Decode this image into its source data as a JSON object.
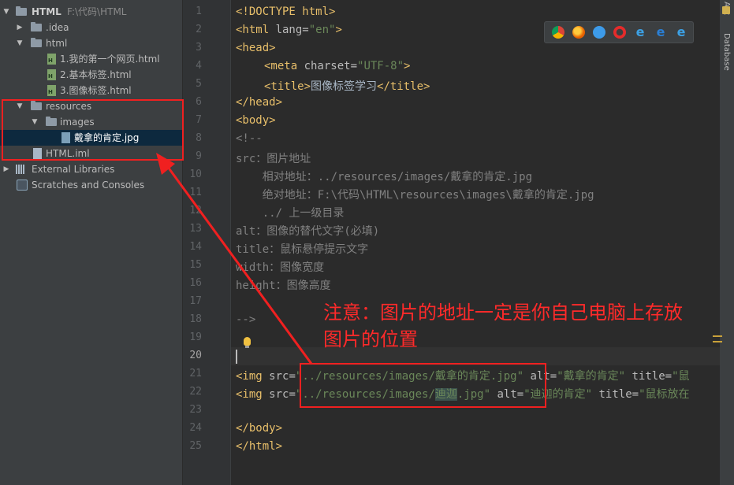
{
  "project_tree": {
    "root_label": "HTML",
    "root_path": "F:\\代码\\HTML",
    "items": [
      {
        "label": "HTML"
      },
      {
        "label": ".idea"
      },
      {
        "label": "html"
      },
      {
        "label": "1.我的第一个网页.html"
      },
      {
        "label": "2.基本标签.html"
      },
      {
        "label": "3.图像标签.html"
      },
      {
        "label": "resources"
      },
      {
        "label": "images"
      },
      {
        "label": "戴拿的肯定.jpg"
      },
      {
        "label": "HTML.iml"
      },
      {
        "label": "External Libraries"
      },
      {
        "label": "Scratches and Consoles"
      }
    ]
  },
  "gutter": {
    "line_numbers": [
      "1",
      "2",
      "3",
      "4",
      "5",
      "6",
      "7",
      "8",
      "9",
      "10",
      "11",
      "12",
      "13",
      "14",
      "15",
      "16",
      "17",
      "18",
      "19",
      "20",
      "21",
      "22",
      "23",
      "24",
      "25"
    ],
    "current_line": "20"
  },
  "editor": {
    "l1": "<!DOCTYPE html>",
    "l2_tag": "<html ",
    "l2_attr": "lang=",
    "l2_val": "\"en\"",
    "l2_close": ">",
    "l3": "<head>",
    "l4_tag": "<meta ",
    "l4_attr": "charset=",
    "l4_val": "\"UTF-8\"",
    "l4_close": ">",
    "l5_open": "<title>",
    "l5_text": "图像标签学习",
    "l5_close": "</title>",
    "l6": "</head>",
    "l7": "<body>",
    "l8": "<!--",
    "l9": "src：图片地址",
    "l10": "    相对地址：../resources/images/戴拿的肯定.jpg",
    "l11": "    绝对地址：F:\\代码\\HTML\\resources\\images\\戴拿的肯定.jpg",
    "l12": "    ../ 上一级目录",
    "l13": "alt：图像的替代文字(必填)",
    "l14": "title：鼠标悬停提示文字",
    "l15": "width：图像宽度",
    "l16": "height：图像高度",
    "l18": "-->",
    "l21": {
      "tag": "<img ",
      "src_attr": "src=",
      "q1": "\"",
      "path": "../resources/images/戴拿的肯定.jpg",
      "q2": "\"",
      "alt_attr": " alt=",
      "alt_val": "\"戴拿的肯定\"",
      "title_attr": " title=",
      "title_val": "\"鼠"
    },
    "l22": {
      "tag": "<img ",
      "src_attr": "src=",
      "q1": "\"",
      "path_a": "../resources/images/",
      "path_b": "迪迦",
      "path_c": ".jpg",
      "q2": "\"",
      "alt_attr": " alt=",
      "alt_val": "\"迪迦的肯定\"",
      "title_attr": " title=",
      "title_val": "\"鼠标放在"
    },
    "l24": "</body>",
    "l25": "</html>"
  },
  "right_strip": {
    "labels": [
      "Ant",
      "Database"
    ]
  },
  "browsers": [
    "chrome-icon",
    "firefox-icon",
    "safari-icon",
    "opera-icon",
    "ie-icon",
    "edge-icon",
    "ie-alt-icon"
  ],
  "annotation": {
    "line1": "注意：图片的地址一定是你自己电脑上存放",
    "line2": "图片的位置",
    "color": "#ff2a2a"
  }
}
